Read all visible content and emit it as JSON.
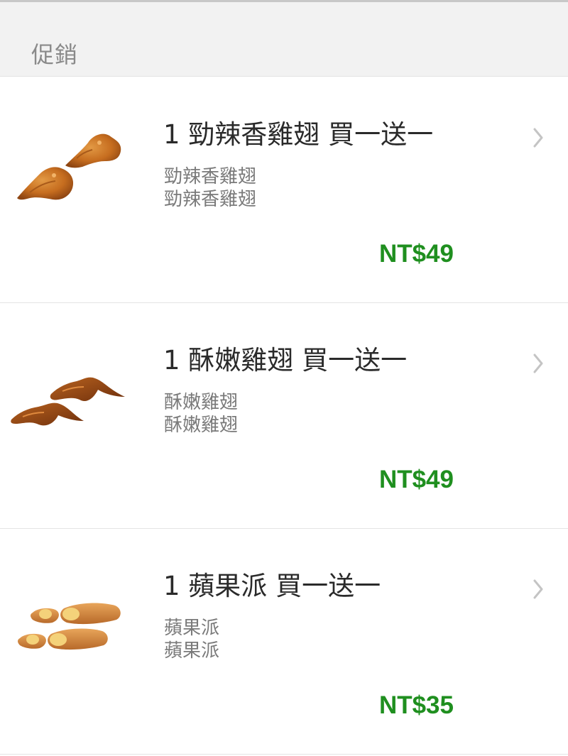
{
  "section": {
    "title": "促銷"
  },
  "items": [
    {
      "title": "1 勁辣香雞翅 買一送一",
      "desc": [
        "勁辣香雞翅",
        "勁辣香雞翅"
      ],
      "price": "NT$49",
      "image": "spicy-chicken-wings-image"
    },
    {
      "title": "1 酥嫩雞翅 買一送一",
      "desc": [
        "酥嫩雞翅",
        "酥嫩雞翅"
      ],
      "price": "NT$49",
      "image": "crispy-chicken-wings-image"
    },
    {
      "title": "1 蘋果派 買一送一",
      "desc": [
        "蘋果派",
        "蘋果派"
      ],
      "price": "NT$35",
      "image": "apple-pie-image"
    }
  ],
  "icons": {
    "chevron": "chevron-right-icon"
  },
  "colors": {
    "price": "#1f8f1f",
    "header_bg": "#f2f2f2",
    "title_text": "#2a2a2a",
    "desc_text": "#7a7a7a"
  }
}
